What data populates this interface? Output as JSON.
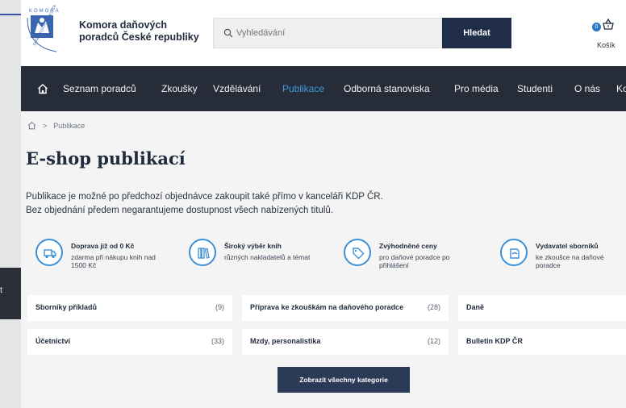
{
  "brand": {
    "logo_text_top": "KOMORA",
    "logo_text_side": "DAŇOVÝCH PORADCŮ ČR",
    "line1": "Komora daňových",
    "line2": "poradců České republiky"
  },
  "search": {
    "placeholder": "Vyhledávání",
    "button_label": "Hledat"
  },
  "cart": {
    "count": "0",
    "label": "Košík"
  },
  "nav": {
    "items": [
      {
        "label": "Seznam poradců"
      },
      {
        "label": "Zkoušky"
      },
      {
        "label": "Vzdělávání"
      },
      {
        "label": "Publikace"
      },
      {
        "label": "Odborná stanoviska"
      },
      {
        "label": "Pro média"
      },
      {
        "label": "Studenti"
      },
      {
        "label": "O nás"
      },
      {
        "label": "Ko"
      }
    ],
    "active_index": 3
  },
  "breadcrumb": {
    "separator": ">",
    "current": "Publikace"
  },
  "page": {
    "title": "E-shop publikací",
    "intro_line1": "Publikace je možné po předchozí objednávce zakoupit také přímo v kanceláři KDP ČR.",
    "intro_line2": "Bez objednání předem negarantujeme dostupnost všech nabízených titulů."
  },
  "features": [
    {
      "icon": "truck-icon",
      "title": "Doprava již od 0 Kč",
      "desc1": "zdarma při nákupu knih nad",
      "desc2": "1500 Kč"
    },
    {
      "icon": "books-icon",
      "title": "Široký výběr knih",
      "desc1": "různých nakladatelů a témat",
      "desc2": ""
    },
    {
      "icon": "price-tag-icon",
      "title": "Zvýhodněné ceny",
      "desc1": "pro daňové poradce po",
      "desc2": "přihlášení"
    },
    {
      "icon": "book-publisher-icon",
      "title": "Vydavatel sborníků",
      "desc1": "ke zkoušce na daňové",
      "desc2": "poradce"
    }
  ],
  "categories": [
    {
      "name": "Sborníky příkladů",
      "count": "(9)"
    },
    {
      "name": "Příprava ke zkouškám na daňového poradce",
      "count": "(28)"
    },
    {
      "name": "Daně",
      "count": ""
    },
    {
      "name": "Účetnictví",
      "count": "(33)"
    },
    {
      "name": "Mzdy, personalistika",
      "count": "(12)"
    },
    {
      "name": "Bulletin KDP ČR",
      "count": ""
    }
  ],
  "all_categories_label": "Zobrazit všechny kategorie",
  "background": {
    "left_fragment": "t"
  },
  "colors": {
    "nav_bg": "#262d38",
    "accent": "#3d9be0",
    "button_dark": "#1f2d49"
  }
}
